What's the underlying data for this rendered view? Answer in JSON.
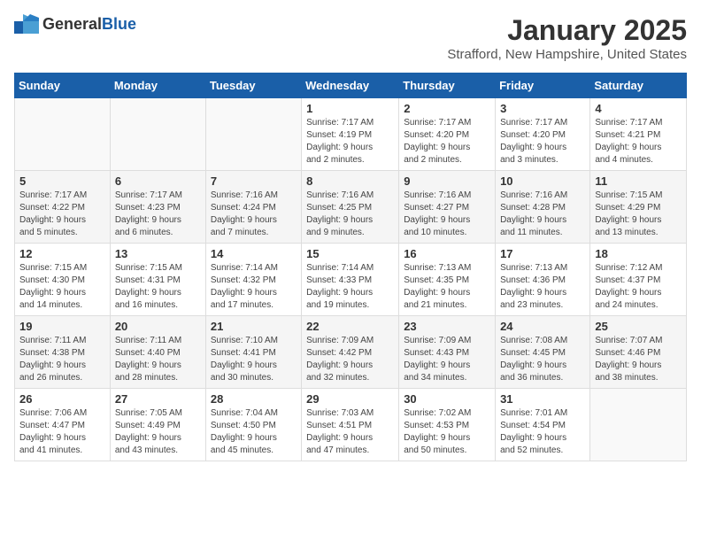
{
  "header": {
    "logo_general": "General",
    "logo_blue": "Blue",
    "month": "January 2025",
    "location": "Strafford, New Hampshire, United States"
  },
  "weekdays": [
    "Sunday",
    "Monday",
    "Tuesday",
    "Wednesday",
    "Thursday",
    "Friday",
    "Saturday"
  ],
  "weeks": [
    [
      {
        "day": "",
        "detail": ""
      },
      {
        "day": "",
        "detail": ""
      },
      {
        "day": "",
        "detail": ""
      },
      {
        "day": "1",
        "detail": "Sunrise: 7:17 AM\nSunset: 4:19 PM\nDaylight: 9 hours\nand 2 minutes."
      },
      {
        "day": "2",
        "detail": "Sunrise: 7:17 AM\nSunset: 4:20 PM\nDaylight: 9 hours\nand 2 minutes."
      },
      {
        "day": "3",
        "detail": "Sunrise: 7:17 AM\nSunset: 4:20 PM\nDaylight: 9 hours\nand 3 minutes."
      },
      {
        "day": "4",
        "detail": "Sunrise: 7:17 AM\nSunset: 4:21 PM\nDaylight: 9 hours\nand 4 minutes."
      }
    ],
    [
      {
        "day": "5",
        "detail": "Sunrise: 7:17 AM\nSunset: 4:22 PM\nDaylight: 9 hours\nand 5 minutes."
      },
      {
        "day": "6",
        "detail": "Sunrise: 7:17 AM\nSunset: 4:23 PM\nDaylight: 9 hours\nand 6 minutes."
      },
      {
        "day": "7",
        "detail": "Sunrise: 7:16 AM\nSunset: 4:24 PM\nDaylight: 9 hours\nand 7 minutes."
      },
      {
        "day": "8",
        "detail": "Sunrise: 7:16 AM\nSunset: 4:25 PM\nDaylight: 9 hours\nand 9 minutes."
      },
      {
        "day": "9",
        "detail": "Sunrise: 7:16 AM\nSunset: 4:27 PM\nDaylight: 9 hours\nand 10 minutes."
      },
      {
        "day": "10",
        "detail": "Sunrise: 7:16 AM\nSunset: 4:28 PM\nDaylight: 9 hours\nand 11 minutes."
      },
      {
        "day": "11",
        "detail": "Sunrise: 7:15 AM\nSunset: 4:29 PM\nDaylight: 9 hours\nand 13 minutes."
      }
    ],
    [
      {
        "day": "12",
        "detail": "Sunrise: 7:15 AM\nSunset: 4:30 PM\nDaylight: 9 hours\nand 14 minutes."
      },
      {
        "day": "13",
        "detail": "Sunrise: 7:15 AM\nSunset: 4:31 PM\nDaylight: 9 hours\nand 16 minutes."
      },
      {
        "day": "14",
        "detail": "Sunrise: 7:14 AM\nSunset: 4:32 PM\nDaylight: 9 hours\nand 17 minutes."
      },
      {
        "day": "15",
        "detail": "Sunrise: 7:14 AM\nSunset: 4:33 PM\nDaylight: 9 hours\nand 19 minutes."
      },
      {
        "day": "16",
        "detail": "Sunrise: 7:13 AM\nSunset: 4:35 PM\nDaylight: 9 hours\nand 21 minutes."
      },
      {
        "day": "17",
        "detail": "Sunrise: 7:13 AM\nSunset: 4:36 PM\nDaylight: 9 hours\nand 23 minutes."
      },
      {
        "day": "18",
        "detail": "Sunrise: 7:12 AM\nSunset: 4:37 PM\nDaylight: 9 hours\nand 24 minutes."
      }
    ],
    [
      {
        "day": "19",
        "detail": "Sunrise: 7:11 AM\nSunset: 4:38 PM\nDaylight: 9 hours\nand 26 minutes."
      },
      {
        "day": "20",
        "detail": "Sunrise: 7:11 AM\nSunset: 4:40 PM\nDaylight: 9 hours\nand 28 minutes."
      },
      {
        "day": "21",
        "detail": "Sunrise: 7:10 AM\nSunset: 4:41 PM\nDaylight: 9 hours\nand 30 minutes."
      },
      {
        "day": "22",
        "detail": "Sunrise: 7:09 AM\nSunset: 4:42 PM\nDaylight: 9 hours\nand 32 minutes."
      },
      {
        "day": "23",
        "detail": "Sunrise: 7:09 AM\nSunset: 4:43 PM\nDaylight: 9 hours\nand 34 minutes."
      },
      {
        "day": "24",
        "detail": "Sunrise: 7:08 AM\nSunset: 4:45 PM\nDaylight: 9 hours\nand 36 minutes."
      },
      {
        "day": "25",
        "detail": "Sunrise: 7:07 AM\nSunset: 4:46 PM\nDaylight: 9 hours\nand 38 minutes."
      }
    ],
    [
      {
        "day": "26",
        "detail": "Sunrise: 7:06 AM\nSunset: 4:47 PM\nDaylight: 9 hours\nand 41 minutes."
      },
      {
        "day": "27",
        "detail": "Sunrise: 7:05 AM\nSunset: 4:49 PM\nDaylight: 9 hours\nand 43 minutes."
      },
      {
        "day": "28",
        "detail": "Sunrise: 7:04 AM\nSunset: 4:50 PM\nDaylight: 9 hours\nand 45 minutes."
      },
      {
        "day": "29",
        "detail": "Sunrise: 7:03 AM\nSunset: 4:51 PM\nDaylight: 9 hours\nand 47 minutes."
      },
      {
        "day": "30",
        "detail": "Sunrise: 7:02 AM\nSunset: 4:53 PM\nDaylight: 9 hours\nand 50 minutes."
      },
      {
        "day": "31",
        "detail": "Sunrise: 7:01 AM\nSunset: 4:54 PM\nDaylight: 9 hours\nand 52 minutes."
      },
      {
        "day": "",
        "detail": ""
      }
    ]
  ]
}
